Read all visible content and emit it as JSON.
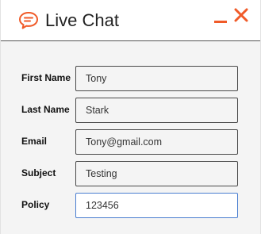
{
  "header": {
    "title": "Live Chat",
    "icon": "chat-bubble-icon",
    "accent_color": "#f05a28"
  },
  "form": {
    "fields": [
      {
        "label": "First Name",
        "value": "Tony"
      },
      {
        "label": "Last Name",
        "value": "Stark"
      },
      {
        "label": "Email",
        "value": "Tony@gmail.com"
      },
      {
        "label": "Subject",
        "value": "Testing"
      },
      {
        "label": "Policy",
        "value": "123456"
      }
    ]
  }
}
